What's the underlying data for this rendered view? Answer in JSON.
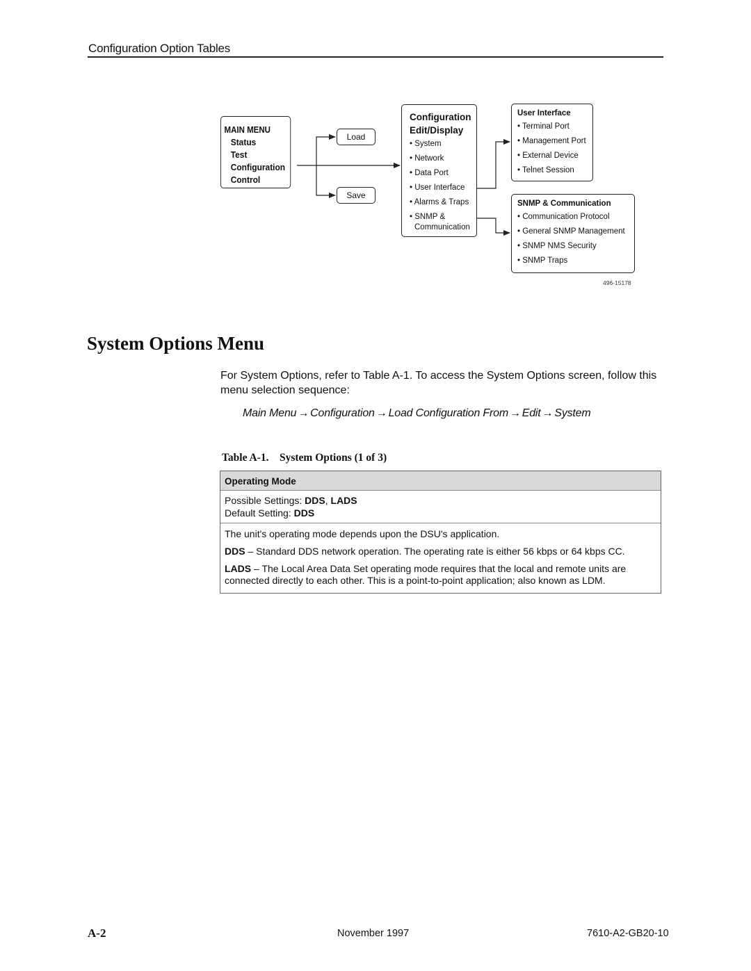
{
  "header": {
    "title": "Configuration Option Tables"
  },
  "diagram": {
    "main_menu": {
      "title": "MAIN MENU",
      "items": [
        "Status",
        "Test",
        "Configuration",
        "Control"
      ]
    },
    "load_label": "Load",
    "save_label": "Save",
    "config_edit": {
      "title_line1": "Configuration",
      "title_line2": "Edit/Display",
      "items": [
        "System",
        "Network",
        "Data Port",
        "User Interface",
        "Alarms & Traps",
        "SNMP &"
      ],
      "item_cont": "Communication"
    },
    "user_interface": {
      "title": "User Interface",
      "items": [
        "Terminal Port",
        "Management Port",
        "External Device",
        "Telnet Session"
      ]
    },
    "snmp": {
      "title": "SNMP & Communication",
      "items": [
        "Communication Protocol",
        "General SNMP Management",
        "SNMP NMS Security",
        "SNMP Traps"
      ]
    },
    "figure_id": "496-15178"
  },
  "section": {
    "title": "System Options Menu",
    "intro": "For System Options, refer to Table A-1. To access the System Options screen, follow this menu selection sequence:",
    "sequence": [
      "Main Menu",
      "Configuration",
      "Load Configuration From",
      "Edit",
      "System"
    ],
    "arrow": "→"
  },
  "table": {
    "caption": "Table A-1.    System Options (1 of 3)",
    "header": "Operating Mode",
    "possible_label": "Possible Settings: ",
    "possible_values": "DDS",
    "possible_sep": ", ",
    "possible_values2": "LADS",
    "default_label": "Default Setting: ",
    "default_value": "DDS",
    "description": "The unit's operating mode depends upon the DSU's application.",
    "dds_term": "DDS",
    "dds_text": " – Standard DDS network operation. The operating rate is either 56 kbps or 64 kbps CC.",
    "lads_term": "LADS",
    "lads_text": " – The Local Area Data Set operating mode requires that the local and remote units are connected directly to each other. This is a point-to-point application; also known as LDM."
  },
  "footer": {
    "page": "A-2",
    "date": "November 1997",
    "doc_number": "7610-A2-GB20-10"
  }
}
